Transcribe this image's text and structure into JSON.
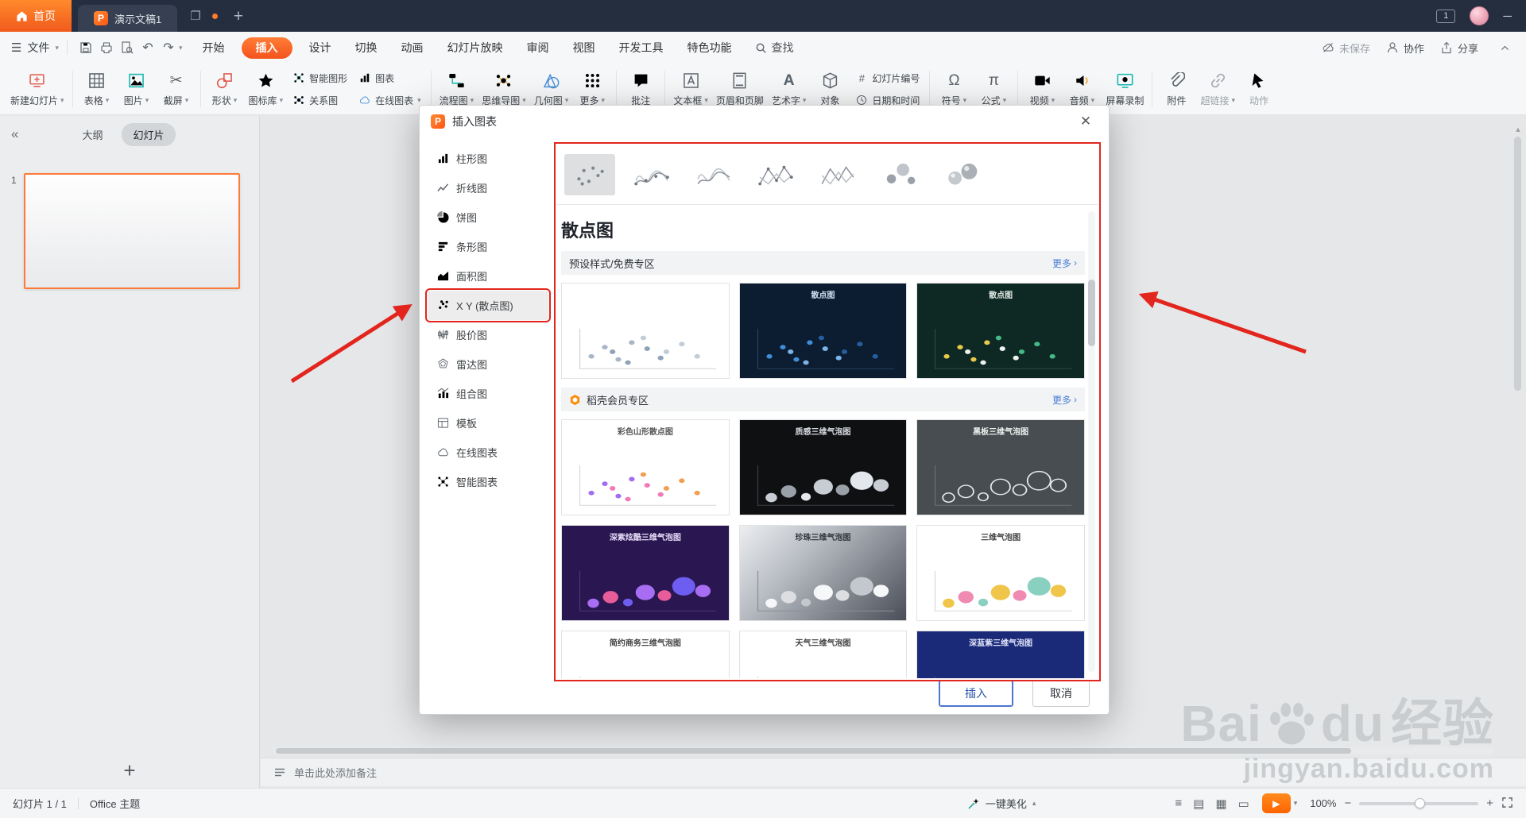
{
  "titlebar": {
    "home": "首页",
    "doc_tab": "演示文稿1",
    "window_count": "1"
  },
  "menubar": {
    "file": "文件",
    "tabs": [
      "开始",
      "插入",
      "设计",
      "切换",
      "动画",
      "幻灯片放映",
      "审阅",
      "视图",
      "开发工具",
      "特色功能"
    ],
    "active_tab": "插入",
    "search": "查找",
    "unsaved": "未保存",
    "collaborate": "协作",
    "share": "分享"
  },
  "toolbar": {
    "items": [
      "新建幻灯片",
      "表格",
      "图片",
      "截屏",
      "形状",
      "图标库",
      "智能图形",
      "关系图",
      "图表",
      "在线图表",
      "流程图",
      "思维导图",
      "几何图",
      "更多",
      "批注",
      "文本框",
      "页眉和页脚",
      "艺术字",
      "对象",
      "幻灯片编号",
      "日期和时间",
      "符号",
      "公式",
      "视频",
      "音频",
      "屏幕录制",
      "附件",
      "超链接",
      "动作"
    ]
  },
  "sidebar": {
    "outline_tab": "大纲",
    "slides_tab": "幻灯片",
    "slide_number": "1"
  },
  "dialog": {
    "title": "插入图表",
    "selected_category": "X Y (散点图)",
    "categories": [
      {
        "label": "柱形图",
        "icon": "bar"
      },
      {
        "label": "折线图",
        "icon": "line"
      },
      {
        "label": "饼图",
        "icon": "pie"
      },
      {
        "label": "条形图",
        "icon": "hbar"
      },
      {
        "label": "面积图",
        "icon": "area"
      },
      {
        "label": "X Y (散点图)",
        "icon": "scatter"
      },
      {
        "label": "股价图",
        "icon": "stock"
      },
      {
        "label": "雷达图",
        "icon": "radar"
      },
      {
        "label": "组合图",
        "icon": "combo"
      },
      {
        "label": "模板",
        "icon": "template"
      },
      {
        "label": "在线图表",
        "icon": "online"
      },
      {
        "label": "智能图表",
        "icon": "smart"
      }
    ],
    "heading": "散点图",
    "sections": [
      {
        "title": "预设样式/免费专区",
        "more": "更多",
        "charts": [
          {
            "title": "",
            "theme": "plain",
            "kind": "scatter"
          },
          {
            "title": "散点图",
            "theme": "navy",
            "kind": "scatter"
          },
          {
            "title": "散点图",
            "theme": "teal",
            "kind": "scatter"
          }
        ]
      },
      {
        "title": "稻壳会员专区",
        "more": "更多",
        "charts": [
          {
            "title": "彩色山形散点图",
            "theme": "colorful",
            "kind": "scatter"
          },
          {
            "title": "质感三维气泡图",
            "theme": "black",
            "kind": "bubble"
          },
          {
            "title": "黑板三维气泡图",
            "theme": "chalk",
            "kind": "bubble"
          },
          {
            "title": "深紫炫酷三维气泡图",
            "theme": "purple",
            "kind": "bubble"
          },
          {
            "title": "珍珠三维气泡图",
            "theme": "pearl",
            "kind": "bubble"
          },
          {
            "title": "三维气泡图",
            "theme": "light",
            "kind": "bubble"
          },
          {
            "title": "简约商务三维气泡图",
            "theme": "light",
            "kind": "bubble"
          },
          {
            "title": "天气三维气泡图",
            "theme": "light",
            "kind": "bubble"
          },
          {
            "title": "深蓝紫三维气泡图",
            "theme": "deepblue",
            "kind": "bubble"
          }
        ]
      }
    ],
    "insert": "插入",
    "cancel": "取消"
  },
  "notes": {
    "placeholder": "单击此处添加备注"
  },
  "statusbar": {
    "slide_indicator": "幻灯片 1 / 1",
    "theme_name": "Office 主题",
    "beautify": "一键美化",
    "zoom": "100%"
  },
  "watermark": {
    "brand_left": "Bai",
    "brand_right": "du",
    "brand_suffix": "经验",
    "url": "jingyan.baidu.com"
  },
  "colors": {
    "accent_orange": "#f4541d",
    "annotation_red": "#e2261d",
    "insert_button_blue": "#4874cb"
  }
}
